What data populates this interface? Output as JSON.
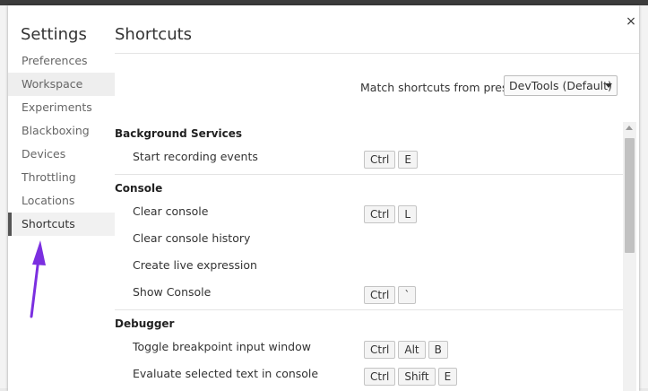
{
  "settings": {
    "title": "Settings",
    "close_label": "×"
  },
  "sidebar": {
    "items": [
      {
        "label": "Preferences"
      },
      {
        "label": "Workspace"
      },
      {
        "label": "Experiments"
      },
      {
        "label": "Blackboxing"
      },
      {
        "label": "Devices"
      },
      {
        "label": "Throttling"
      },
      {
        "label": "Locations"
      },
      {
        "label": "Shortcuts"
      }
    ]
  },
  "shortcuts": {
    "title": "Shortcuts",
    "preset_label": "Match shortcuts from preset",
    "preset_value": "DevTools (Default)",
    "categories": [
      {
        "name": "Background Services",
        "items": [
          {
            "name": "Start recording events",
            "keys": [
              "Ctrl",
              "E"
            ]
          }
        ]
      },
      {
        "name": "Console",
        "items": [
          {
            "name": "Clear console",
            "keys": [
              "Ctrl",
              "L"
            ]
          },
          {
            "name": "Clear console history",
            "keys": []
          },
          {
            "name": "Create live expression",
            "keys": []
          },
          {
            "name": "Show Console",
            "keys": [
              "Ctrl",
              "`"
            ]
          }
        ]
      },
      {
        "name": "Debugger",
        "items": [
          {
            "name": "Toggle breakpoint input window",
            "keys": [
              "Ctrl",
              "Alt",
              "B"
            ]
          },
          {
            "name": "Evaluate selected text in console",
            "keys": [
              "Ctrl",
              "Shift",
              "E"
            ]
          }
        ]
      }
    ]
  },
  "annotation": {
    "arrow_color": "#7b2fe0"
  }
}
